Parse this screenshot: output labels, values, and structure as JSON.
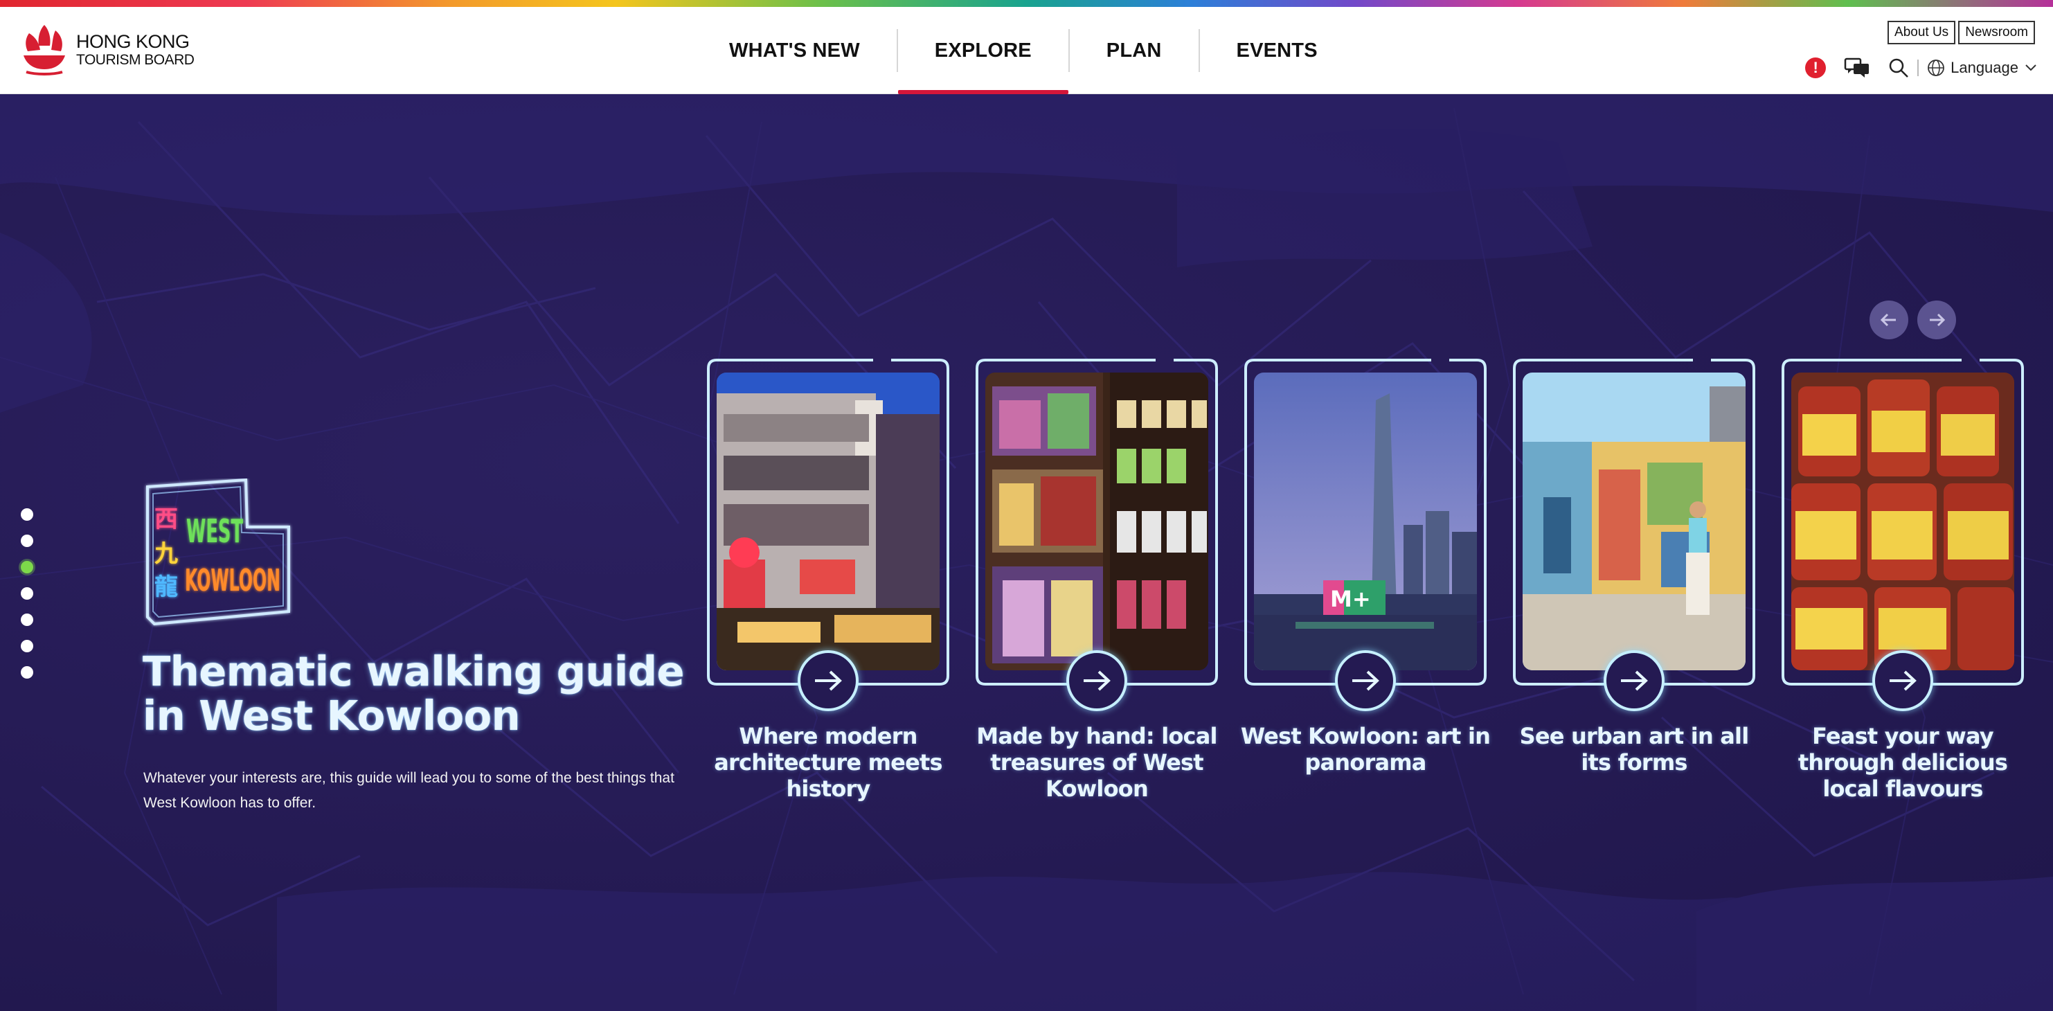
{
  "logo": {
    "line1": "HONG KONG",
    "line2": "TOURISM BOARD"
  },
  "nav": {
    "items": [
      {
        "label": "WHAT'S NEW"
      },
      {
        "label": "EXPLORE"
      },
      {
        "label": "PLAN"
      },
      {
        "label": "EVENTS"
      }
    ],
    "active": "EXPLORE"
  },
  "utility": {
    "about": "About Us",
    "newsroom": "Newsroom",
    "alert": "!",
    "language": "Language",
    "icons": [
      "alert-icon",
      "chat-icon",
      "search-icon",
      "globe-icon",
      "chevron-down-icon"
    ]
  },
  "hero": {
    "logo_lines": [
      "西",
      "九",
      "龍",
      "WEST",
      "KOWLOON"
    ],
    "title": "Thematic walking guide in West Kowloon",
    "description": "Whatever your interests are, this guide will lead you to some of the best things that West Kowloon has to offer.",
    "slide_count": 7,
    "active_slide": 3
  },
  "cards": [
    {
      "title": "Where modern architecture meets history",
      "image": "neon-building-photo"
    },
    {
      "title": "Made by hand: local treasures of West Kowloon",
      "image": "embroidered-slippers-photo"
    },
    {
      "title": "West Kowloon: art in panorama",
      "image": "skyline-m-plus-photo"
    },
    {
      "title": "See urban art in all its forms",
      "image": "mural-street-photo"
    },
    {
      "title": "Feast your way through delicious local flavours",
      "image": "sauce-jars-photo"
    }
  ],
  "colors": {
    "background": "#241a52",
    "accent_red": "#d4163a",
    "glow": "#c6efff",
    "active_dot": "#7dd94a"
  }
}
